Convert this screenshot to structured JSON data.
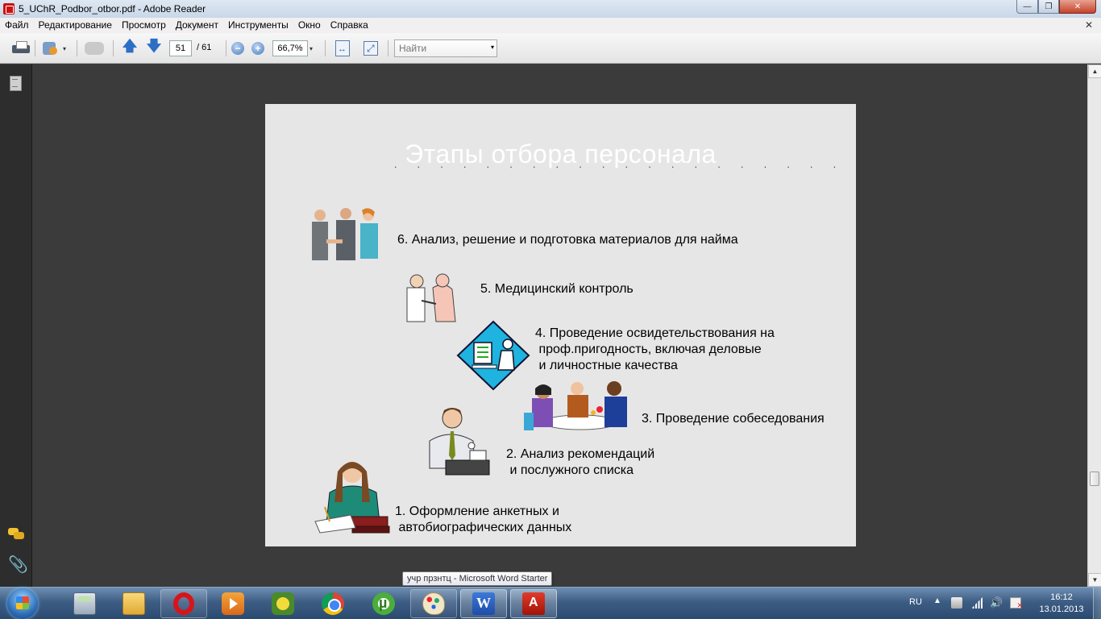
{
  "window": {
    "title": "5_UChR_Podbor_otbor.pdf - Adobe Reader",
    "controls": {
      "minimize": "—",
      "maximize": "❐",
      "close": "✕"
    }
  },
  "menu": {
    "items": [
      "Файл",
      "Редактирование",
      "Просмотр",
      "Документ",
      "Инструменты",
      "Окно",
      "Справка"
    ],
    "close_glyph": "✕"
  },
  "toolbar": {
    "current_page": "51",
    "total_pages": "/ 61",
    "zoom": "66,7%",
    "search_placeholder": "Найти",
    "prev_glyph": "🡅",
    "next_glyph": "🡇",
    "zoom_out_glyph": "−",
    "zoom_in_glyph": "+",
    "dropdown_glyph": "▾"
  },
  "slide": {
    "title": "Этапы отбора персонала",
    "title_dots": ". . . . . . . . . . . . . . . . . . . .",
    "steps": [
      {
        "lines": [
          "6. Анализ, решение и подготовка материалов для найма"
        ]
      },
      {
        "lines": [
          "5. Медицинский контроль"
        ]
      },
      {
        "lines": [
          "4. Проведение освидетельствования на",
          " проф.пригодность, включая деловые",
          " и личностные качества"
        ]
      },
      {
        "lines": [
          "3. Проведение собеседования"
        ]
      },
      {
        "lines": [
          "2. Анализ рекомендаций",
          " и послужного списка"
        ]
      },
      {
        "lines": [
          "1. Оформление анкетных и",
          " автобиографических данных"
        ]
      }
    ]
  },
  "scrollbar": {
    "up_glyph": "▲",
    "down_glyph": "▼"
  },
  "taskbar": {
    "tooltip": "учр прзнтц - Microsoft Word Starter",
    "language": "RU",
    "tray_arrow": "▲",
    "volume_glyph": "🔊",
    "time": "16:12",
    "date": "13.01.2013",
    "apps": [
      "calculator",
      "windows-explorer",
      "opera",
      "media-player",
      "robot-app",
      "chrome",
      "utorrent",
      "paint",
      "microsoft-word",
      "adobe-reader"
    ]
  },
  "colors": {
    "document_background": "#3b3b3b",
    "page_background": "#e6e6e6",
    "slide_title": "#ffffff",
    "taskbar": "#3e5d84"
  }
}
